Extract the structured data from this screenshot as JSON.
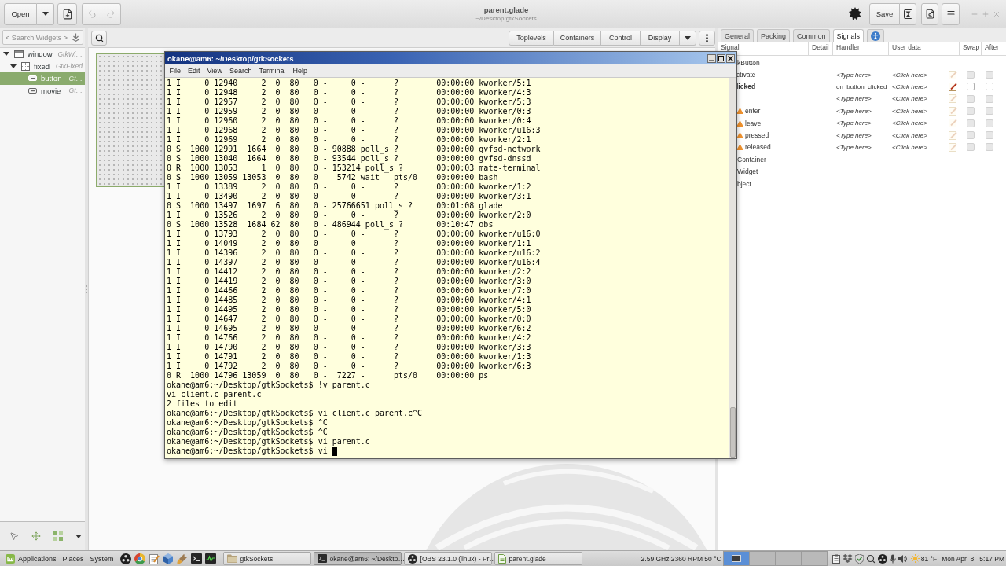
{
  "header": {
    "open_label": "Open",
    "undo": {
      "disabled": true
    },
    "redo": {
      "disabled": true
    },
    "title": "parent.glade",
    "subtitle": "~/Desktop/gtkSockets",
    "save_label": "Save"
  },
  "palette": {
    "search": {
      "placeholder": "< Search Widgets >"
    },
    "tree": [
      {
        "kind": "window",
        "name": "window",
        "type": "GtkWi…",
        "expanded": true,
        "selected": false,
        "children": [
          {
            "kind": "fixed",
            "name": "fixed",
            "type": "GtkFixed",
            "expanded": true,
            "selected": false,
            "children": [
              {
                "kind": "button",
                "name": "button",
                "type": "Gt…",
                "selected": true
              },
              {
                "kind": "button",
                "name": "movie",
                "type": "Gt…",
                "selected": false
              }
            ]
          }
        ]
      }
    ]
  },
  "toolbar": {
    "groups": [
      "Toplevels",
      "Containers",
      "Control",
      "Display"
    ]
  },
  "inspector": {
    "tabs": [
      {
        "kind": "text",
        "label": "General",
        "selected": false
      },
      {
        "kind": "text",
        "label": "Packing",
        "selected": false
      },
      {
        "kind": "text",
        "label": "Common",
        "selected": false
      },
      {
        "kind": "text",
        "label": "Signals",
        "selected": true
      },
      {
        "kind": "accessibility",
        "selected": false
      }
    ],
    "columns": [
      "Signal",
      "Detail",
      "Handler",
      "User data",
      "Swap",
      "After"
    ],
    "rows": [
      {
        "kind": "group",
        "name": "kButton"
      },
      {
        "kind": "signal",
        "name": "ctivate",
        "handler": "<Type here>",
        "user_data": "<Click here>",
        "connected": false,
        "swap": false,
        "after": false
      },
      {
        "kind": "signal",
        "name": "licked",
        "handler": "on_button_clicked",
        "user_data": "<Click here>",
        "connected": true,
        "swap": false,
        "after": false
      },
      {
        "kind": "signal",
        "handler": "<Type here>",
        "user_data": "<Click here>",
        "connected": false,
        "swap": false,
        "after": false
      },
      {
        "kind": "signal",
        "name": "enter",
        "warning": true,
        "handler": "<Type here>",
        "user_data": "<Click here>",
        "connected": false,
        "swap": false,
        "after": false
      },
      {
        "kind": "signal",
        "name": "leave",
        "warning": true,
        "handler": "<Type here>",
        "user_data": "<Click here>",
        "connected": false,
        "swap": false,
        "after": false
      },
      {
        "kind": "signal",
        "name": "pressed",
        "warning": true,
        "handler": "<Type here>",
        "user_data": "<Click here>",
        "connected": false,
        "swap": false,
        "after": false
      },
      {
        "kind": "signal",
        "name": "released",
        "warning": true,
        "handler": "<Type here>",
        "user_data": "<Click here>",
        "connected": false,
        "swap": false,
        "after": false
      },
      {
        "kind": "group",
        "name": "Container"
      },
      {
        "kind": "group",
        "name": "Widget"
      },
      {
        "kind": "group",
        "name": "bject"
      }
    ]
  },
  "terminal": {
    "title": "okane@am6: ~/Desktop/gtkSockets",
    "menu": [
      "File",
      "Edit",
      "View",
      "Search",
      "Terminal",
      "Help"
    ],
    "lines": [
      "1 I     0 12940     2  0  80   0 -     0 -      ?        00:00:00 kworker/5:1",
      "1 I     0 12948     2  0  80   0 -     0 -      ?        00:00:00 kworker/4:3",
      "1 I     0 12957     2  0  80   0 -     0 -      ?        00:00:00 kworker/5:3",
      "1 I     0 12959     2  0  80   0 -     0 -      ?        00:00:00 kworker/0:3",
      "1 I     0 12960     2  0  80   0 -     0 -      ?        00:00:00 kworker/0:4",
      "1 I     0 12968     2  0  80   0 -     0 -      ?        00:00:00 kworker/u16:3",
      "1 I     0 12969     2  0  80   0 -     0 -      ?        00:00:00 kworker/2:1",
      "0 S  1000 12991  1664  0  80   0 - 90888 poll_s ?        00:00:00 gvfsd-network",
      "0 S  1000 13040  1664  0  80   0 - 93544 poll_s ?        00:00:00 gvfsd-dnssd",
      "0 R  1000 13053     1  0  80   0 - 153214 poll_s ?       00:00:03 mate-terminal",
      "0 S  1000 13059 13053  0  80   0 -  5742 wait   pts/0    00:00:00 bash",
      "1 I     0 13389     2  0  80   0 -     0 -      ?        00:00:00 kworker/1:2",
      "1 I     0 13490     2  0  80   0 -     0 -      ?        00:00:00 kworker/3:1",
      "0 S  1000 13497  1697  6  80   0 - 25766651 poll_s ?     00:01:08 glade",
      "1 I     0 13526     2  0  80   0 -     0 -      ?        00:00:00 kworker/2:0",
      "0 S  1000 13528  1684 62  80   0 - 486944 poll_s ?       00:10:47 obs",
      "1 I     0 13793     2  0  80   0 -     0 -      ?        00:00:00 kworker/u16:0",
      "1 I     0 14049     2  0  80   0 -     0 -      ?        00:00:00 kworker/1:1",
      "1 I     0 14396     2  0  80   0 -     0 -      ?        00:00:00 kworker/u16:2",
      "1 I     0 14397     2  0  80   0 -     0 -      ?        00:00:00 kworker/u16:4",
      "1 I     0 14412     2  0  80   0 -     0 -      ?        00:00:00 kworker/2:2",
      "1 I     0 14419     2  0  80   0 -     0 -      ?        00:00:00 kworker/3:0",
      "1 I     0 14466     2  0  80   0 -     0 -      ?        00:00:00 kworker/7:0",
      "1 I     0 14485     2  0  80   0 -     0 -      ?        00:00:00 kworker/4:1",
      "1 I     0 14495     2  0  80   0 -     0 -      ?        00:00:00 kworker/5:0",
      "1 I     0 14647     2  0  80   0 -     0 -      ?        00:00:00 kworker/0:0",
      "1 I     0 14695     2  0  80   0 -     0 -      ?        00:00:00 kworker/6:2",
      "1 I     0 14766     2  0  80   0 -     0 -      ?        00:00:00 kworker/4:2",
      "1 I     0 14790     2  0  80   0 -     0 -      ?        00:00:00 kworker/3:3",
      "1 I     0 14791     2  0  80   0 -     0 -      ?        00:00:00 kworker/1:3",
      "1 I     0 14792     2  0  80   0 -     0 -      ?        00:00:00 kworker/6:3",
      "0 R  1000 14796 13059  0  80   0 -  7227 -      pts/0    00:00:00 ps",
      "okane@am6:~/Desktop/gtkSockets$ !v parent.c",
      "vi client.c parent.c",
      "2 files to edit",
      "okane@am6:~/Desktop/gtkSockets$ vi client.c parent.c^C",
      "okane@am6:~/Desktop/gtkSockets$ ^C",
      "okane@am6:~/Desktop/gtkSockets$ ^C",
      "okane@am6:~/Desktop/gtkSockets$ vi parent.c",
      "okane@am6:~/Desktop/gtkSockets$ vi"
    ],
    "cursor": true
  },
  "taskbar": {
    "menus": [
      {
        "kind": "logo",
        "label": "Applications"
      },
      {
        "kind": "plain",
        "label": "Places"
      },
      {
        "kind": "plain",
        "label": "System"
      }
    ],
    "windows": [
      {
        "kind": "folder",
        "label": "gtkSockets",
        "selected": false
      },
      {
        "kind": "terminal",
        "label": "okane@am6: ~/Deskto…",
        "selected": true
      },
      {
        "kind": "obs",
        "label": "[OBS 23.1.0 (linux) - Pr…",
        "selected": false
      },
      {
        "kind": "glade",
        "label": "parent.glade",
        "selected": false
      }
    ],
    "sensors": "2.59 GHz 2360 RPM 50 °C",
    "workspaces": [
      {
        "selected": true
      },
      {
        "selected": false
      },
      {
        "selected": false
      },
      {
        "selected": false
      }
    ],
    "weather": "81 °F",
    "clock": "Mon Apr  8,  5:17 PM"
  }
}
